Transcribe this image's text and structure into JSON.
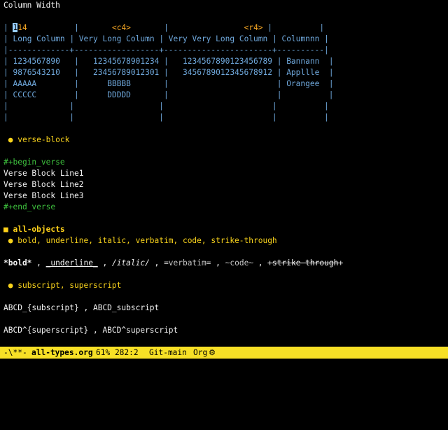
{
  "buffer": {
    "title": "Column Width",
    "table": {
      "align_row": {
        "c1_cursor": "1",
        "c1_rest": "14",
        "c2": "<c4>",
        "c3": "<r4>"
      },
      "header": [
        "Long Column",
        "Very Long Column",
        "Very Very Long Column",
        "Columnnn"
      ],
      "separator": "|-------------+------------------+-----------------------+----------|",
      "rows": [
        [
          "1234567890",
          "12345678901234",
          "1234567890123456789",
          "Bannann"
        ],
        [
          "9876543210",
          "23456789012301",
          "3456789012345678912",
          "Appllle"
        ],
        [
          "AAAAA",
          "BBBBB",
          "",
          "Orangee"
        ],
        [
          "CCCCC",
          "DDDDD",
          "",
          ""
        ],
        [
          "",
          "",
          "",
          ""
        ],
        [
          "",
          "",
          "",
          ""
        ]
      ]
    },
    "verse_heading": "verse-block",
    "verse_begin": "#+begin_verse",
    "verse_lines": [
      "Verse Block Line1",
      "Verse Block Line2",
      "Verse Block Line3"
    ],
    "verse_end": "#+end_verse",
    "all_objects_heading": "all-objects",
    "markup_heading": "bold, underline, italic, verbatim, code, strike-through",
    "markup_line": {
      "bold": "*bold*",
      "underline": "_underline_",
      "italic": "/italic/",
      "verbatim": "=verbatim=",
      "code": "~code~",
      "strike": "+strike through+",
      "sep": " , "
    },
    "script_heading": "subscript, superscript",
    "subscript_line": "ABCD_{subscript} , ABCD_subscript",
    "superscript_line": "ABCD^{superscript} , ABCD^superscript"
  },
  "modeline": {
    "state": "-\\**-",
    "filename": "all-types.org",
    "position": "61% 282:2",
    "vcs": "Git-main",
    "mode": "Org",
    "mode_icon": "gear-icon"
  },
  "colors": {
    "table": "#6fa8dc",
    "alignment_cookie": "#f5a623",
    "heading": "#f8d21c",
    "keyword": "#3ec23e",
    "modeline_bg": "#f7e026"
  }
}
